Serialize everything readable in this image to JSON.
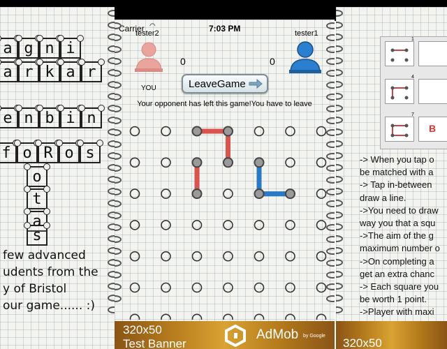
{
  "left_panel": {
    "tile_rows": [
      [
        "a",
        "g",
        "n",
        "i"
      ],
      [
        "a",
        "r",
        "k",
        "a",
        "r"
      ],
      [
        "e",
        "n",
        "b",
        "i",
        "n"
      ],
      [
        "f",
        "o",
        "R",
        "o",
        "s"
      ],
      [
        "o"
      ],
      [
        "t"
      ],
      [
        "a"
      ],
      [
        "s"
      ]
    ],
    "caption_lines": [
      "few advanced",
      "udents from the",
      "y of Bristol",
      "our game...... :)"
    ]
  },
  "center_panel": {
    "status_bar": {
      "carrier": "Carrier",
      "time": "7:03 PM"
    },
    "player_left": {
      "name": "tester2",
      "score": "0",
      "you_label": "YOU",
      "color": "#e07b7b"
    },
    "player_right": {
      "name": "tester1",
      "score": "0",
      "color": "#2b7fd0"
    },
    "leave_button": "LeaveGame",
    "message": "Your opponent has left this game!You have to leave",
    "board": {
      "rows": 7,
      "cols": 7,
      "red": "#d9534f",
      "blue": "#2979c7"
    },
    "banner": {
      "size_text": "320x50",
      "test_text": "Test Banner",
      "brand": "AdMob",
      "by": "by Google"
    }
  },
  "right_panel": {
    "mini_numbers": [
      "1",
      "4",
      "7"
    ],
    "mini_letter": "B",
    "instructions": [
      "-> When you tap o",
      "be matched with a",
      "-> Tap in-between",
      "draw a line.",
      "->You need to draw",
      "way you that a squ",
      "->The aim of the g",
      "maximum number o",
      "->On completing a",
      "get an extra chanc",
      "-> Each square you",
      "be worth 1 point.",
      "->Player with maxi"
    ],
    "banner_text": "320x50"
  }
}
